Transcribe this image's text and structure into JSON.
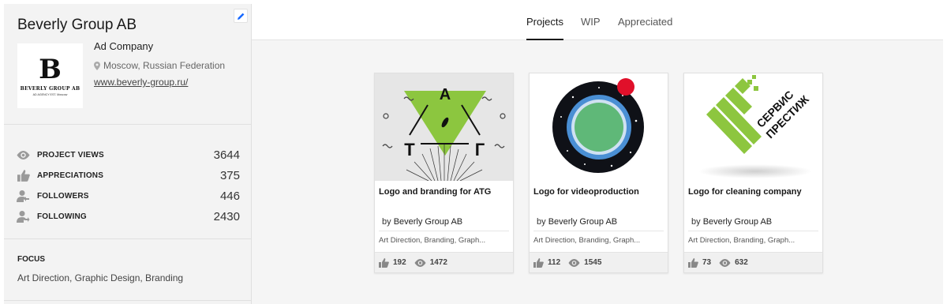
{
  "profile": {
    "name": "Beverly Group AB",
    "company": "Ad Company",
    "location": "Moscow, Russian Federation",
    "website": "www.beverly-group.ru/",
    "logo": {
      "monogram": "B",
      "text": "BEVERLY GROUP AB",
      "sub": "AD AGENCY EST. Moscow"
    }
  },
  "stats": [
    {
      "label": "PROJECT VIEWS",
      "value": "3644",
      "icon": "eye-icon"
    },
    {
      "label": "APPRECIATIONS",
      "value": "375",
      "icon": "thumbs-up-icon"
    },
    {
      "label": "FOLLOWERS",
      "value": "446",
      "icon": "follower-icon"
    },
    {
      "label": "FOLLOWING",
      "value": "2430",
      "icon": "following-icon"
    }
  ],
  "focus": {
    "title": "FOCUS",
    "text": "Art Direction, Graphic Design, Branding"
  },
  "tabs": [
    {
      "label": "Projects",
      "active": true
    },
    {
      "label": "WIP",
      "active": false
    },
    {
      "label": "Appreciated",
      "active": false
    }
  ],
  "projects": [
    {
      "title": "Logo and branding for ATG",
      "by": "by",
      "author": "Beverly Group AB",
      "fields": "Art Direction, Branding, Graph...",
      "appreciations": "192",
      "views": "1472",
      "art": {
        "top": "A",
        "left": "T",
        "right": "Г"
      }
    },
    {
      "title": "Logo for videoproduction",
      "by": "by",
      "author": "Beverly Group AB",
      "fields": "Art Direction, Branding, Graph...",
      "appreciations": "112",
      "views": "1545"
    },
    {
      "title": "Logo for cleaning company",
      "by": "by",
      "author": "Beverly Group AB",
      "fields": "Art Direction, Branding, Graph...",
      "appreciations": "73",
      "views": "632",
      "art": {
        "line1": "СЕРВИС",
        "line2": "ПРЕСТИЖ"
      }
    }
  ],
  "colors": {
    "edit_icon": "#1769ff",
    "atg_green": "#8cc63f",
    "video_red": "#e0102a",
    "video_blue": "#4a8fd4",
    "video_green": "#5fb878",
    "cleaning_green": "#8dc63f"
  }
}
